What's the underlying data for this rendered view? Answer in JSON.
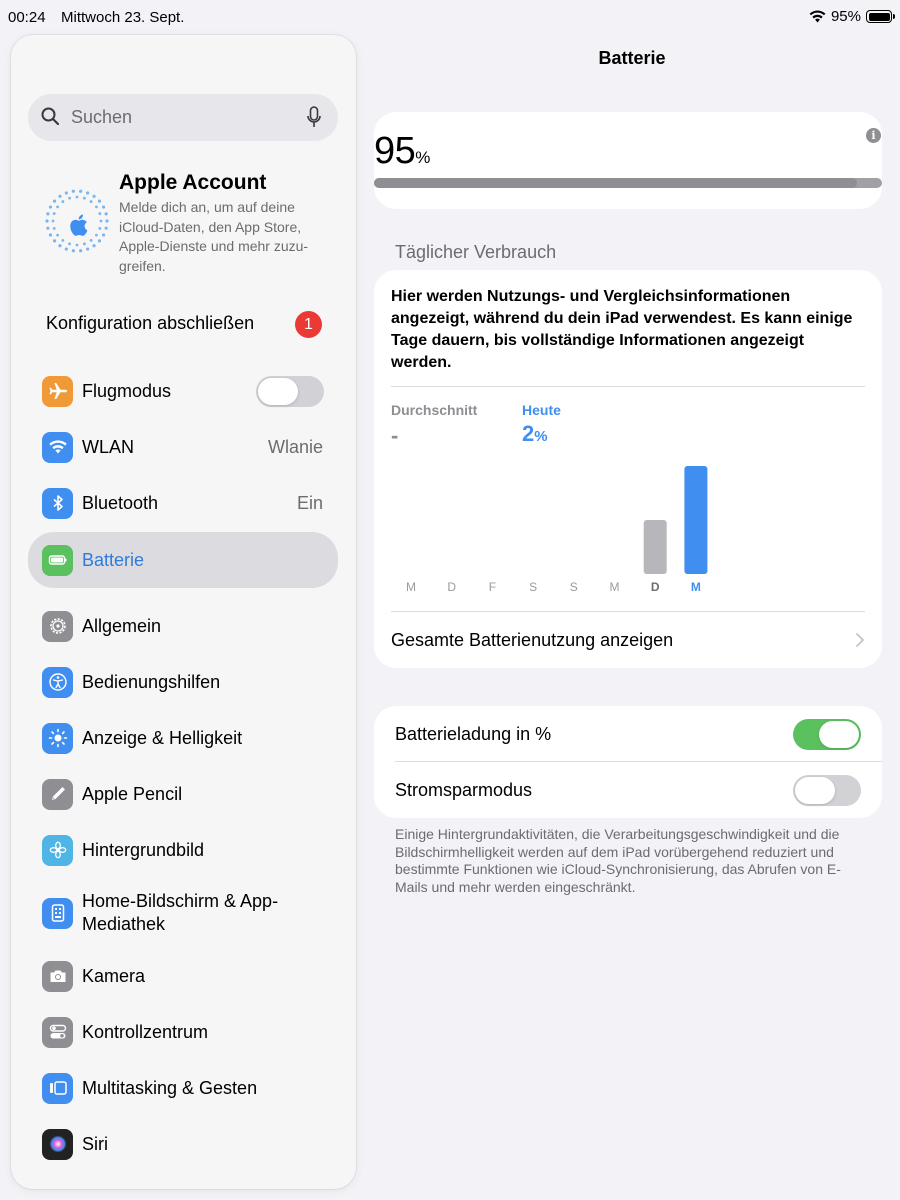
{
  "status_bar": {
    "time": "00:24",
    "date": "Mittwoch 23. Sept.",
    "battery_pct": "95%"
  },
  "sidebar": {
    "search_placeholder": "Suchen",
    "account": {
      "title": "Apple Account",
      "description": "Melde dich an, um auf deine iCloud-Daten, den App Store, Apple-Dienste und mehr zuzu-greifen."
    },
    "config": {
      "label": "Konfiguration abschließen",
      "badge": "1"
    },
    "items": [
      {
        "label": "Flugmodus",
        "icon": "airplane-icon",
        "color": "#f09a37",
        "toggle": false
      },
      {
        "label": "WLAN",
        "icon": "wifi-icon",
        "color": "#3f8ef0",
        "value": "Wlanie"
      },
      {
        "label": "Bluetooth",
        "icon": "bluetooth-icon",
        "color": "#3f8ef0",
        "value": "Ein"
      },
      {
        "label": "Batterie",
        "icon": "battery-icon",
        "color": "#5ac15e",
        "selected": true
      },
      {
        "label": "Allgemein",
        "icon": "gear-icon",
        "color": "#8e8e93"
      },
      {
        "label": "Bedienungshilfen",
        "icon": "accessibility-icon",
        "color": "#3f8ef0"
      },
      {
        "label": "Anzeige & Helligkeit",
        "icon": "sun-icon",
        "color": "#3f8ef0"
      },
      {
        "label": "Apple Pencil",
        "icon": "pencil-icon",
        "color": "#8e8e93"
      },
      {
        "label": "Hintergrundbild",
        "icon": "flower-icon",
        "color": "#4fb5e6"
      },
      {
        "label": "Home-Bildschirm & App-Mediathek",
        "icon": "home-screen-icon",
        "color": "#3f8ef0"
      },
      {
        "label": "Kamera",
        "icon": "camera-icon",
        "color": "#8e8e93"
      },
      {
        "label": "Kontrollzentrum",
        "icon": "control-center-icon",
        "color": "#8e8e93"
      },
      {
        "label": "Multitasking & Gesten",
        "icon": "multitasking-icon",
        "color": "#3f8ef0"
      },
      {
        "label": "Siri",
        "icon": "siri-icon",
        "color": "#222222"
      }
    ]
  },
  "main": {
    "title": "Batterie",
    "battery_level": {
      "value": "95",
      "unit": "%",
      "fraction": 0.95
    },
    "daily_header": "Täglicher Verbrauch",
    "usage_info": "Hier werden Nutzungs- und Vergleichsinformationen angezeigt, während du dein iPad verwendest. Es kann einige Tage dauern, bis vollständige Informationen angezeigt werden.",
    "average_label": "Durchschnitt",
    "average_value": "-",
    "today_label": "Heute",
    "today_value": "2",
    "today_unit": "%",
    "show_all_label": "Gesamte Batterienutzung anzeigen",
    "battery_pct_label": "Batterieladung in %",
    "battery_pct_toggle": true,
    "low_power_label": "Stromsparmodus",
    "low_power_toggle": false,
    "footnote": "Einige Hintergrundaktivitäten, die Verarbeitungsgeschwindigkeit und die Bildschirmhelligkeit werden auf dem iPad vorübergehend reduziert und bestimmte Funktionen wie iCloud-Synchronisierung, das Abrufen von E-Mails und mehr werden eingeschränkt."
  },
  "chart_data": {
    "type": "bar",
    "categories": [
      "M",
      "D",
      "F",
      "S",
      "S",
      "M",
      "D",
      "M"
    ],
    "values": [
      0,
      0,
      0,
      0,
      0,
      0,
      1,
      2
    ],
    "highlight_index": 7,
    "colors": {
      "default": "#b6b6bb",
      "highlight": "#3f8ef0"
    }
  }
}
